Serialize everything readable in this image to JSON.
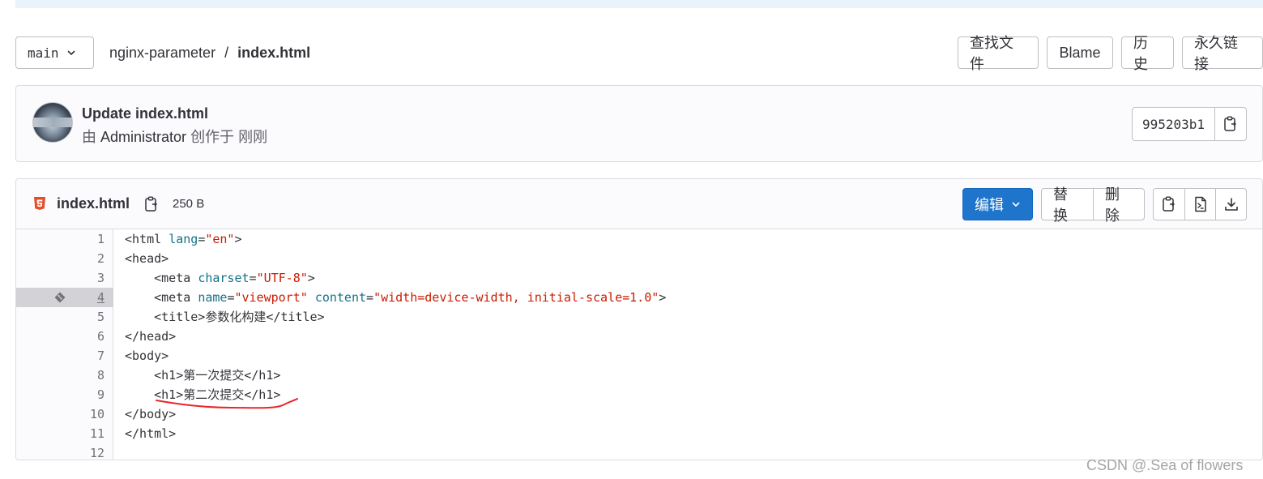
{
  "nav": {
    "branch": "main",
    "breadcrumb_project": "nginx-parameter",
    "breadcrumb_separator": "/",
    "breadcrumb_file": "index.html",
    "actions": [
      "查找文件",
      "Blame",
      "历史",
      "永久链接"
    ]
  },
  "commit": {
    "title": "Update index.html",
    "meta_prefix": "由",
    "author": "Administrator",
    "meta_suffix": "创作于 刚刚",
    "sha": "995203b1"
  },
  "file": {
    "name": "index.html",
    "size": "250 B",
    "edit_label": "编辑",
    "replace_label": "替换",
    "delete_label": "删除",
    "highlighted_line": 4,
    "lines": [
      {
        "n": "1"
      },
      {
        "n": "2"
      },
      {
        "n": "3"
      },
      {
        "n": "4"
      },
      {
        "n": "5"
      },
      {
        "n": "6"
      },
      {
        "n": "7"
      },
      {
        "n": "8"
      },
      {
        "n": "9"
      },
      {
        "n": "10"
      },
      {
        "n": "11"
      },
      {
        "n": "12"
      }
    ],
    "code": {
      "l1_open": "<html ",
      "l1_attr": "lang",
      "l1_eq": "=",
      "l1_val": "\"en\"",
      "l1_close": ">",
      "l2": "<head>",
      "l3_open": "    <meta ",
      "l3_attr": "charset",
      "l3_eq": "=",
      "l3_val": "\"UTF-8\"",
      "l3_close": ">",
      "l4_open": "    <meta ",
      "l4_attr1": "name",
      "l4_eq1": "=",
      "l4_val1": "\"viewport\"",
      "l4_sp": " ",
      "l4_attr2": "content",
      "l4_eq2": "=",
      "l4_val2": "\"width=device-width, initial-scale=1.0\"",
      "l4_close": ">",
      "l5": "    <title>参数化构建</title>",
      "l6": "</head>",
      "l7": "<body>",
      "l8": "    <h1>第一次提交</h1>",
      "l9": "    <h1>第二次提交</h1>",
      "l10": "</body>",
      "l11": "</html>",
      "l12": ""
    }
  },
  "watermark": "CSDN @.Sea of flowers",
  "colors": {
    "primary": "#1f75cb",
    "attr": "#11728a",
    "value": "#c91c00",
    "annotation": "#e8272a"
  }
}
